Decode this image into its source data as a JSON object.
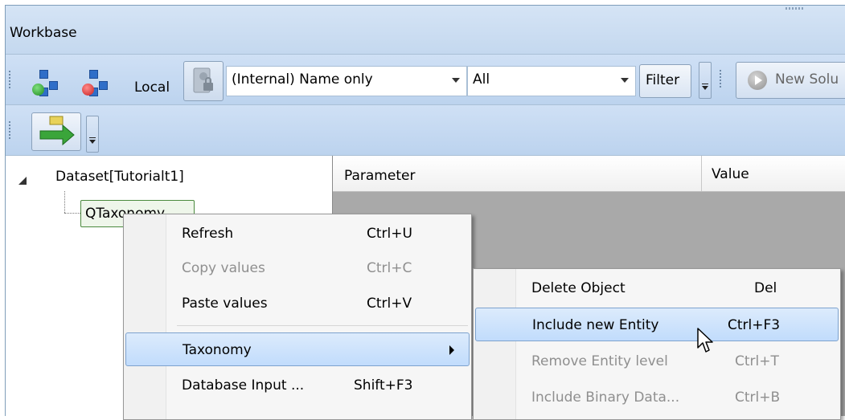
{
  "window": {
    "title": "Workbase"
  },
  "toolbar": {
    "connect_icon": "database-connect-icon",
    "disconnect_icon": "database-disconnect-icon",
    "local_label": "Local",
    "name_combo_value": "(Internal) Name only",
    "all_combo_value": "All",
    "filter_label": "Filter",
    "new_solution_label": "New Solu",
    "export_icon": "export-arrow-icon"
  },
  "tree": {
    "root_label": "Dataset[Tutorialt1]",
    "child_label": "QTaxonomy"
  },
  "grid": {
    "columns": [
      "Parameter",
      "Value"
    ]
  },
  "context_menu": {
    "items": [
      {
        "label": "Refresh",
        "shortcut": "Ctrl+U",
        "enabled": true
      },
      {
        "label": "Copy values",
        "shortcut": "Ctrl+C",
        "enabled": false
      },
      {
        "label": "Paste values",
        "shortcut": "Ctrl+V",
        "enabled": true
      },
      {
        "label": "Taxonomy",
        "shortcut": "",
        "enabled": true,
        "submenu": true
      },
      {
        "label": "Database Input ...",
        "shortcut": "Shift+F3",
        "enabled": true
      }
    ]
  },
  "submenu": {
    "items": [
      {
        "label": "Delete Object",
        "shortcut": "Del",
        "enabled": true
      },
      {
        "label": "Include new Entity",
        "shortcut": "Ctrl+F3",
        "enabled": true
      },
      {
        "label": "Remove Entity level",
        "shortcut": "Ctrl+T",
        "enabled": false
      },
      {
        "label": "Include Binary Data...",
        "shortcut": "Ctrl+B",
        "enabled": false
      }
    ]
  },
  "colors": {
    "toolbar": "#c4d8ef",
    "highlight": "#c1dcfc",
    "highlight_border": "#7da2ce",
    "disabled_text": "#8f8f8f"
  }
}
